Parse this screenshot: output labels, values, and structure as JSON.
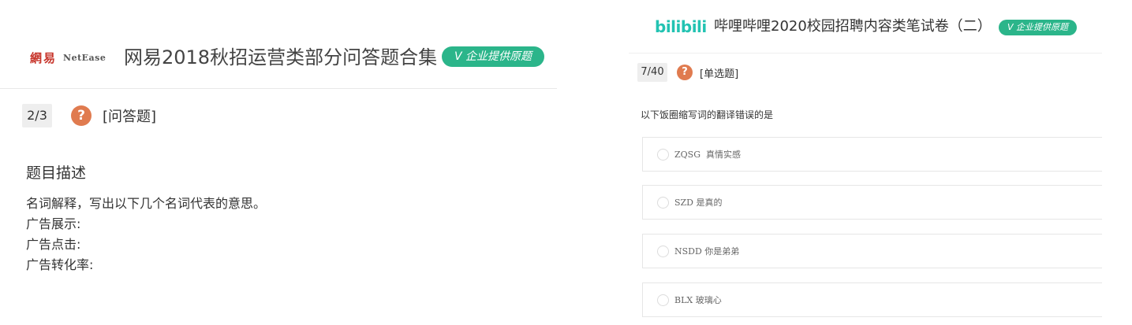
{
  "left": {
    "logo_cn": "網易",
    "logo_en": "NetEase",
    "title": "网易2018秋招运营类部分问答题合集",
    "badge": "V 企业提供原题",
    "counter": "2/3",
    "question_icon": "question-mark-icon",
    "question_type": "[问答题]",
    "description_title": "题目描述",
    "description_lines": [
      "名词解释，写出以下几个名词代表的意思。",
      "广告展示:",
      "广告点击:",
      "广告转化率:"
    ]
  },
  "right": {
    "logo": "bilibili",
    "title": "哔哩哔哩2020校园招聘内容类笔试卷（二）",
    "badge": "V 企业提供原题",
    "counter": "7/40",
    "question_icon": "question-mark-icon",
    "question_type": "[单选题]",
    "prompt": "以下饭圈缩写词的翻译错误的是",
    "options": [
      "ZQSG  真情实感",
      "SZD 是真的",
      "NSDD 你是弟弟",
      "BLX 玻璃心"
    ]
  },
  "colors": {
    "badge_green": "#2bb58a",
    "question_icon_orange": "#e07b4f",
    "netease_red": "#c7352b",
    "bilibili_teal": "#23c3b2"
  }
}
